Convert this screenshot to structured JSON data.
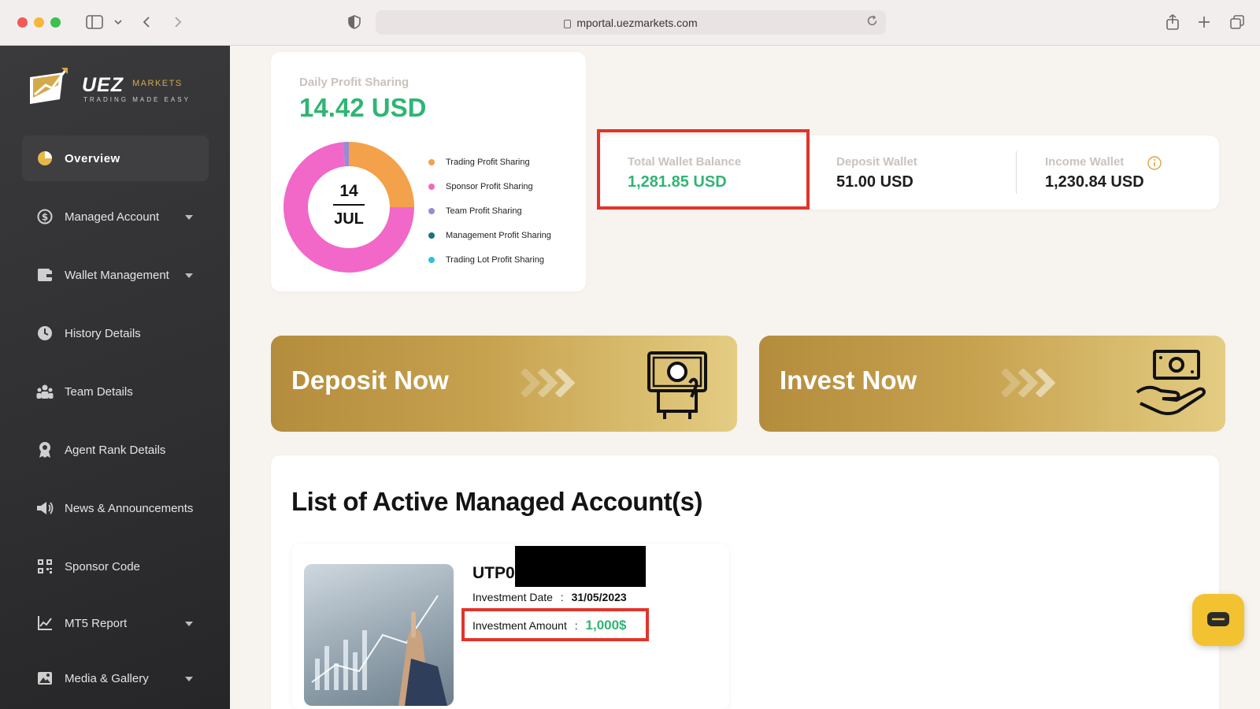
{
  "browser": {
    "url": "mportal.uezmarkets.com"
  },
  "sidebar": {
    "logo": {
      "brand": "UEZ",
      "suffix": "MARKETS",
      "tagline": "TRADING MADE EASY"
    },
    "items": [
      {
        "label": "Overview",
        "icon": "pie-chart-icon",
        "active": true,
        "has_caret": false
      },
      {
        "label": "Managed Account",
        "icon": "dollar-coin-icon",
        "has_caret": true
      },
      {
        "label": "Wallet Management",
        "icon": "wallet-icon",
        "has_caret": true
      },
      {
        "label": "History Details",
        "icon": "clock-icon",
        "has_caret": false
      },
      {
        "label": "Team Details",
        "icon": "team-icon",
        "has_caret": false
      },
      {
        "label": "Agent Rank Details",
        "icon": "award-icon",
        "has_caret": false
      },
      {
        "label": "News & Announcements",
        "icon": "megaphone-icon",
        "has_caret": false
      },
      {
        "label": "Sponsor Code",
        "icon": "qr-code-icon",
        "has_caret": false
      },
      {
        "label": "MT5 Report",
        "icon": "line-chart-icon",
        "has_caret": true
      },
      {
        "label": "Media & Gallery",
        "icon": "gallery-icon",
        "has_caret": true
      }
    ]
  },
  "profit_card": {
    "title": "Daily Profit Sharing",
    "value": "14.42 USD",
    "date_day": "14",
    "date_month": "JUL",
    "legend": [
      {
        "label": "Trading Profit Sharing",
        "color": "#f4a14b"
      },
      {
        "label": "Sponsor Profit Sharing",
        "color": "#f168c8"
      },
      {
        "label": "Team Profit Sharing",
        "color": "#9b8ad6"
      },
      {
        "label": "Management Profit Sharing",
        "color": "#1f6f7f"
      },
      {
        "label": "Trading Lot Profit Sharing",
        "color": "#2bc3d8"
      }
    ],
    "chart_data": {
      "type": "pie",
      "categories": [
        "Trading Profit Sharing",
        "Sponsor Profit Sharing",
        "Team Profit Sharing",
        "Management Profit Sharing",
        "Trading Lot Profit Sharing"
      ],
      "values": [
        25,
        73.5,
        1.5,
        0,
        0
      ],
      "colors": [
        "#f4a14b",
        "#f168c8",
        "#9b8ad6",
        "#1f6f7f",
        "#2bc3d8"
      ]
    }
  },
  "wallets": {
    "total": {
      "label": "Total Wallet Balance",
      "value": "1,281.85 USD"
    },
    "deposit": {
      "label": "Deposit Wallet",
      "value": "51.00 USD"
    },
    "income": {
      "label": "Income Wallet",
      "value": "1,230.84 USD",
      "info_icon": "info-icon"
    }
  },
  "banners": {
    "deposit": {
      "label": "Deposit Now",
      "icon": "money-deposit-icon"
    },
    "invest": {
      "label": "Invest Now",
      "icon": "hand-money-icon"
    }
  },
  "accounts": {
    "title": "List of Active Managed Account(s)",
    "items": [
      {
        "id_prefix": "UTP0",
        "date_label": "Investment Date",
        "date_value": "31/05/2023",
        "amount_label": "Investment Amount",
        "amount_value": "1,000$",
        "separator": ":"
      }
    ]
  },
  "colors": {
    "accent_green": "#2fb574",
    "highlight_red": "#e2342a",
    "gold": "#c6a14e",
    "chat_yellow": "#f2c230"
  }
}
